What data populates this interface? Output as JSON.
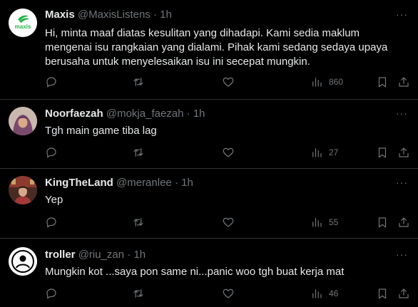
{
  "tweets": [
    {
      "name": "Maxis",
      "handle": "@MaxisListens",
      "separator": "·",
      "time": "1h",
      "avatar_label": "maxis",
      "text": "Hi, minta maaf diatas kesulitan yang dihadapi. Kami sedia maklum mengenai isu rangkaian yang dialami. Pihak kami sedang sedaya upaya berusaha untuk menyelesaikan isu ini secepat mungkin.",
      "views": "860",
      "more": "···"
    },
    {
      "name": "Noorfaezah",
      "handle": "@mokja_faezah",
      "separator": "·",
      "time": "1h",
      "text": "Tgh main game tiba lag",
      "views": "27",
      "more": "···"
    },
    {
      "name": "KingTheLand",
      "handle": "@meranlee",
      "separator": "·",
      "time": "1h",
      "text": "Yep",
      "views": "55",
      "more": "···"
    },
    {
      "name": "troller",
      "handle": "@riu_zan",
      "separator": "·",
      "time": "1h",
      "text": "Mungkin kot ...saya pon same ni...panic woo tgh buat kerja mat",
      "views": "46",
      "more": "···"
    }
  ],
  "colors": {
    "background": "#000000",
    "text": "#e7e9ea",
    "secondary": "#71767b",
    "divider": "#2f3336",
    "maxis_green": "#27b24a"
  }
}
